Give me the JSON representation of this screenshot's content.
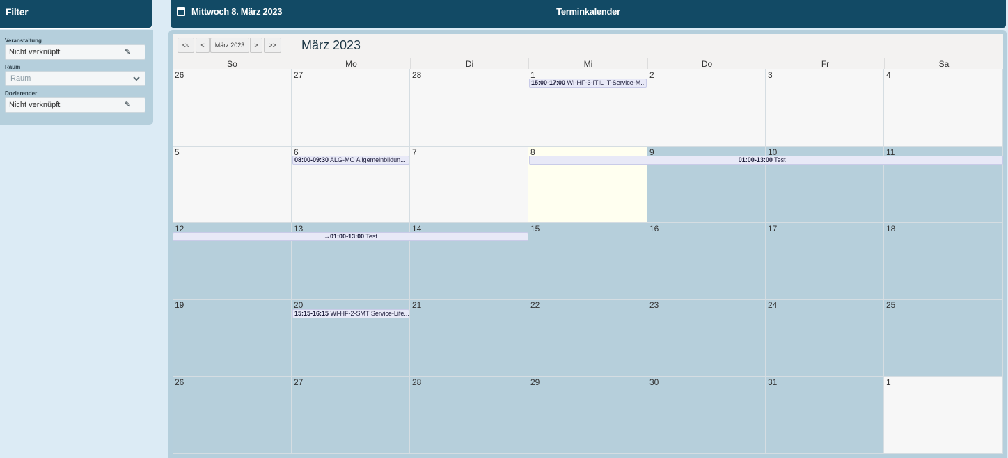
{
  "filter": {
    "title": "Filter",
    "veranstaltung_label": "Veranstaltung",
    "veranstaltung_value": "Nicht verknüpft",
    "raum_label": "Raum",
    "raum_placeholder": "Raum",
    "dozierender_label": "Dozierender",
    "dozierender_value": "Nicht verknüpft"
  },
  "header": {
    "date": "Mittwoch 8. März 2023",
    "title": "Terminkalender"
  },
  "toolbar": {
    "first": "<<",
    "prev": "<",
    "current": "März 2023",
    "next": ">",
    "last": ">>",
    "month_title": "März 2023"
  },
  "daynames": [
    "So",
    "Mo",
    "Di",
    "Mi",
    "Do",
    "Fr",
    "Sa"
  ],
  "weeks": [
    [
      "26",
      "27",
      "28",
      "1",
      "2",
      "3",
      "4"
    ],
    [
      "5",
      "6",
      "7",
      "8",
      "9",
      "10",
      "11"
    ],
    [
      "12",
      "13",
      "14",
      "15",
      "16",
      "17",
      "18"
    ],
    [
      "19",
      "20",
      "21",
      "22",
      "23",
      "24",
      "25"
    ],
    [
      "26",
      "27",
      "28",
      "29",
      "30",
      "31",
      "1"
    ]
  ],
  "events": [
    {
      "time": "15:00-17:00",
      "text": " WI-HF-3-ITIL IT-Service-M..."
    },
    {
      "time": "08:00-09:30",
      "text": " ALG-MO Allgemeinbildun..."
    },
    {
      "time": "01:00-13:00",
      "text": " Test →"
    },
    {
      "time": "→01:00-13:00",
      "text": " Test"
    },
    {
      "time": "15:15-16:15",
      "text": " WI-HF-2-SMT Service-Life..."
    }
  ],
  "colors": {
    "header": "#124a65",
    "panel": "#b5cfdc",
    "today": "#fffff0",
    "event": "#e8e9f7"
  }
}
